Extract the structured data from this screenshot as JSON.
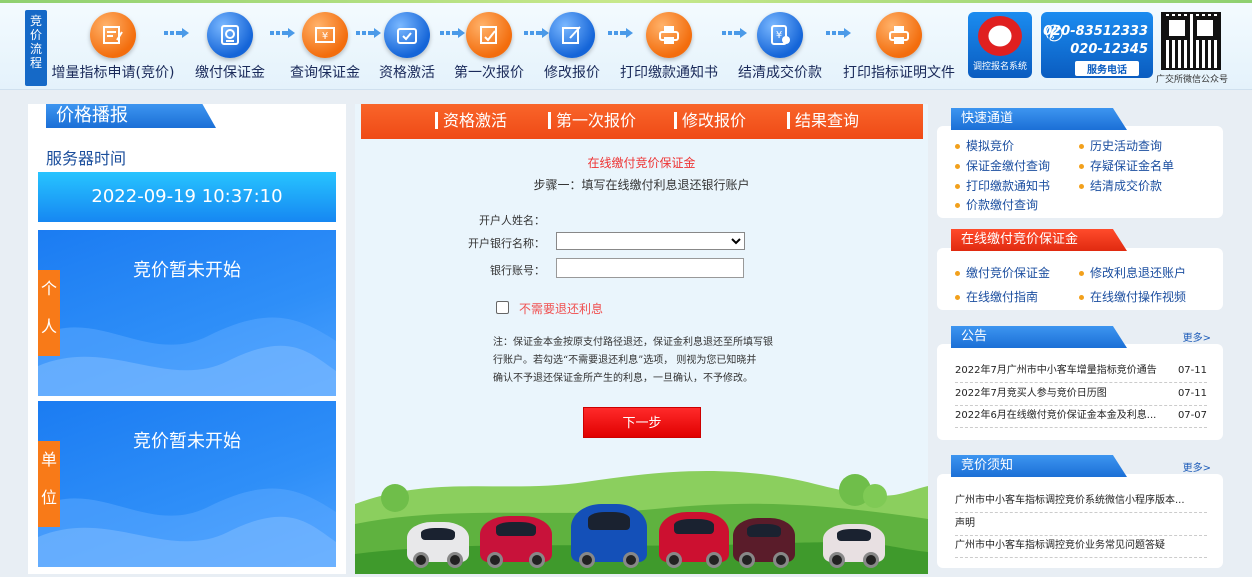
{
  "header": {
    "flow_label": "竞价流程",
    "steps": [
      {
        "label": "增量指标申请(竞价)",
        "icon": "application-form-icon",
        "color": "orange"
      },
      {
        "label": "缴付保证金",
        "icon": "deposit-receipt-icon",
        "color": "blue"
      },
      {
        "label": "查询保证金",
        "icon": "deposit-query-icon",
        "color": "orange"
      },
      {
        "label": "资格激活",
        "icon": "activation-box-icon",
        "color": "blue"
      },
      {
        "label": "第一次报价",
        "icon": "first-bid-icon",
        "color": "orange"
      },
      {
        "label": "修改报价",
        "icon": "modify-bid-icon",
        "color": "blue"
      },
      {
        "label": "打印缴款通知书",
        "icon": "printer-icon",
        "color": "orange"
      },
      {
        "label": "结清成交价款",
        "icon": "settle-payment-icon",
        "color": "blue"
      },
      {
        "label": "打印指标证明文件",
        "icon": "printer-icon",
        "color": "orange"
      }
    ],
    "system_logo_caption": "调控报名系统",
    "phone1": "020-83512333",
    "phone2": "020-12345",
    "service_label": "服务电话",
    "qr_caption": "广交所微信公众号"
  },
  "left": {
    "title": "价格播报",
    "server_time_label": "服务器时间",
    "server_time": "2022-09-19 10:37:10",
    "personal": {
      "status": "竞价暂未开始",
      "side": [
        "个",
        "人"
      ]
    },
    "unit": {
      "status": "竞价暂未开始",
      "side": [
        "单",
        "位"
      ]
    }
  },
  "center": {
    "tabs": [
      "资格激活",
      "第一次报价",
      "修改报价",
      "结果查询"
    ],
    "form_title": "在线缴付竞价保证金",
    "form_sub": "步骤一：填写在线缴付利息退还银行账户",
    "account_name_label": "开户人姓名：",
    "bank_name_label": "开户银行名称：",
    "bank_account_label": "银行账号：",
    "no_refund_label": "不需要退还利息",
    "note_lines": [
      "注：保证金本金按原支付路径退还，保证金利息退还至所填写银",
      "行账户。若勾选“不需要退还利息”选项， 则视为您已知晓并",
      "确认不予退还保证金所产生的利息，一旦确认，不予修改。"
    ],
    "next_button": "下一步"
  },
  "right": {
    "quick": {
      "title": "快速通道",
      "links": [
        "模拟竞价",
        "历史活动查询",
        "保证金缴付查询",
        "存疑保证金名单",
        "打印缴款通知书",
        "结清成交价款",
        "价款缴付查询"
      ]
    },
    "online": {
      "title": "在线缴付竞价保证金",
      "links": [
        "缴付竞价保证金",
        "修改利息退还账户",
        "在线缴付指南",
        "在线缴付操作视频"
      ]
    },
    "notice": {
      "title": "公告",
      "more": "更多>",
      "items": [
        {
          "title": "2022年7月广州市中小客车增量指标竞价通告",
          "date": "07-11"
        },
        {
          "title": "2022年7月竞买人参与竞价日历图",
          "date": "07-11"
        },
        {
          "title": "2022年6月在线缴付竞价保证金本金及利息...",
          "date": "07-07"
        }
      ]
    },
    "rules": {
      "title": "竞价须知",
      "more": "更多>",
      "items": [
        "广州市中小客车指标调控竞价系统微信小程序版本...",
        "声明",
        "广州市中小客车指标调控竞价业务常见问题答疑"
      ]
    }
  },
  "colors": {
    "orange": "#f36d0d",
    "blue": "#1565d8",
    "tab_orange": "#f15a22",
    "button_red": "#ee0000",
    "link_dot": "#f2a01c"
  }
}
